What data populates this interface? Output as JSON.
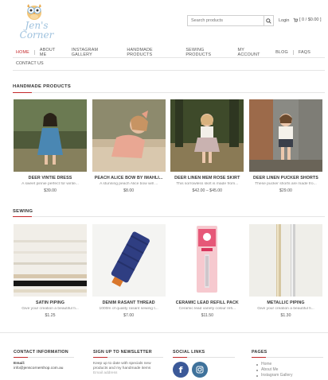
{
  "header": {
    "logo_text_line1": "Jen's",
    "logo_text_line2": "Corner",
    "search_placeholder": "Search products",
    "login_label": "Login",
    "cart_label": "[ 0 / $0.00 ]"
  },
  "nav": {
    "items": [
      {
        "label": "HOME",
        "active": true
      },
      {
        "label": "ABOUT ME"
      },
      {
        "label": "INSTAGRAM GALLERY"
      },
      {
        "label": "HANDMADE PRODUCTS"
      },
      {
        "label": "SEWING PRODUCTS"
      },
      {
        "label": "MY ACCOUNT"
      },
      {
        "label": "BLOG"
      },
      {
        "label": "FAQS"
      }
    ],
    "contact_label": "CONTACT US"
  },
  "handmade": {
    "title": "HANDMADE  PRODUCTS",
    "products": [
      {
        "name": "DEER VINTIE DRESS",
        "desc": "A sweet pinnie perfect for winte...",
        "price": "$39.00",
        "image": "girl-blue-dress-photo"
      },
      {
        "name": "PEACH ALICE BOW BY IMAHLI...",
        "desc": "A stunning peach Alice bow will ...",
        "price": "$8.00",
        "image": "girl-peach-bow-photo"
      },
      {
        "name": "DEER LINEN MEM ROSE SKIRT",
        "desc": "This sorrowless skirt is made from...",
        "price": "$42.00 – $45.00",
        "image": "girl-rose-skirt-photo"
      },
      {
        "name": "DEER LINEN PUCKER SHORTS",
        "desc": "These pucker shorts are made fro...",
        "price": "$29.00",
        "image": "girl-pucker-shorts-photo"
      }
    ]
  },
  "sewing": {
    "title": "SEWING",
    "products": [
      {
        "name": "SATIN PIPING",
        "desc": "Give your creation a beautiful fi...",
        "price": "$1.25",
        "image": "satin-piping-photo"
      },
      {
        "name": "DENIM RASANT THREAD",
        "desc": "1000m of quality rasant sewing t...",
        "price": "$7.00",
        "image": "navy-thread-spool-photo"
      },
      {
        "name": "CERAMIC LEAD REFILL PACK",
        "desc": "Ceramic lead variety colour refi...",
        "price": "$11.50",
        "image": "sewline-lead-refill-photo"
      },
      {
        "name": "METALLIC PIPING",
        "desc": "Give your creation a beautiful fi...",
        "price": "$1.30",
        "image": "metallic-piping-photo"
      }
    ]
  },
  "footer": {
    "contact": {
      "title": "CONTACT INFORMATION",
      "email_label": "Email:",
      "email": "info@jenscornershop.com.au"
    },
    "newsletter": {
      "title": "SIGN UP TO NEWSLETTER",
      "text": "Keep up to date with specials new products and my handmade items",
      "email_placeholder": "Email address"
    },
    "social": {
      "title": "SOCIAL LINKS",
      "facebook_color": "#3b5998",
      "instagram_color": "#3f729b"
    },
    "pages": {
      "title": "PAGES",
      "items": [
        "Home",
        "About Me",
        "Instagram Gallery"
      ]
    }
  },
  "colors": {
    "accent": "#c4282b",
    "logo": "#9fc2de"
  }
}
